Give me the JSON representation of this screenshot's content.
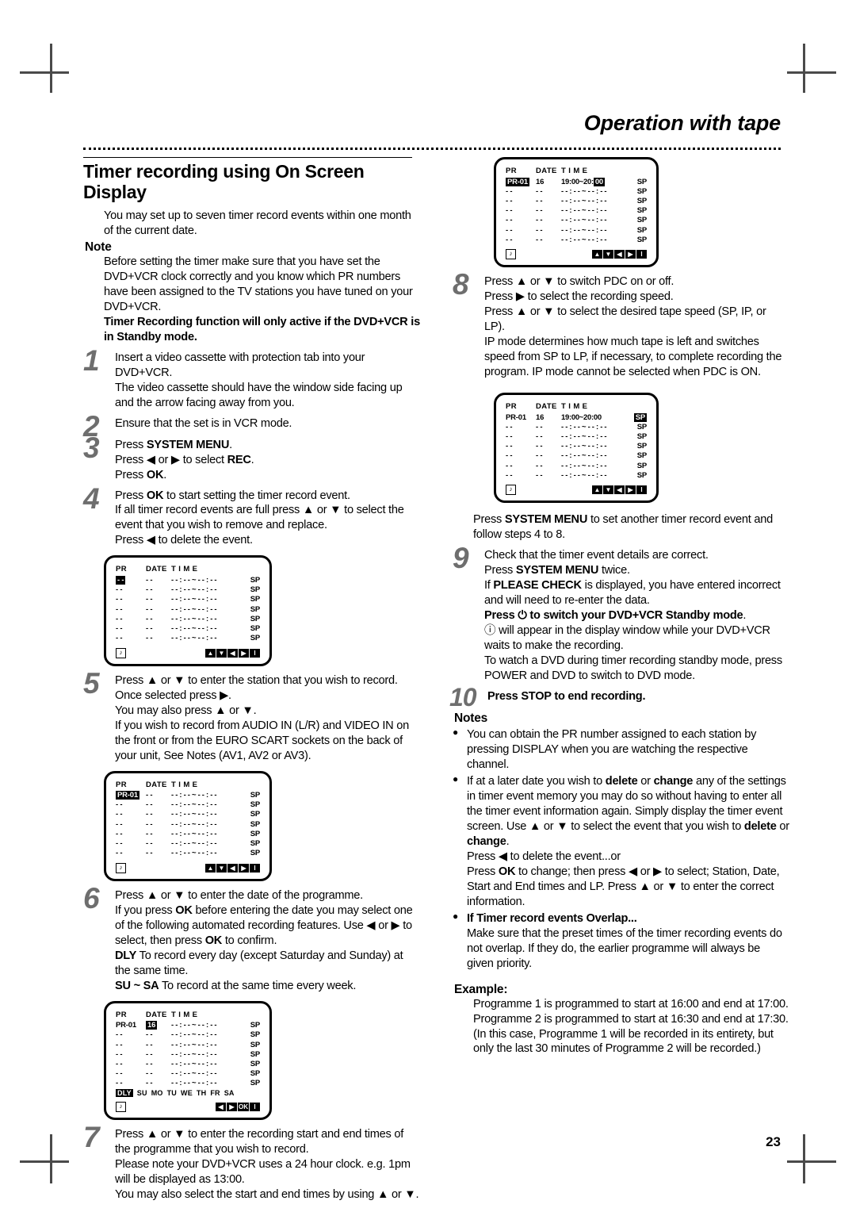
{
  "header": {
    "title": "Operation with tape"
  },
  "page_number": "23",
  "section": {
    "title_line1": "Timer recording using On Screen",
    "title_line2": "Display",
    "intro": "You may set up to seven timer record events within one month of the current date.",
    "note_heading": "Note",
    "note_body": "Before setting the timer make sure that you have set the DVD+VCR clock correctly and you know which PR numbers have been assigned to the TV stations you have tuned on your DVD+VCR.",
    "note_bold": "Timer Recording function will only active if the DVD+VCR is in Standby mode."
  },
  "steps": {
    "s1": {
      "num": "1",
      "line1": "Insert a video cassette with protection tab into your DVD+VCR.",
      "line2": "The video cassette should have the window side facing up and the arrow facing away from you."
    },
    "s2": {
      "num": "2",
      "line1": "Ensure that the set is in VCR mode."
    },
    "s3": {
      "num": "3",
      "l1a": "Press ",
      "l1b": "SYSTEM MENU",
      "l1c": ".",
      "l2a": "Press ◀ or ▶ to select ",
      "l2b": "REC",
      "l2c": ".",
      "l3a": "Press ",
      "l3b": "OK",
      "l3c": "."
    },
    "s4": {
      "num": "4",
      "l1a": "Press ",
      "l1b": "OK",
      "l1c": " to start setting the timer record event.",
      "line2": "If all timer record events are full press ▲ or ▼ to select the event that you wish to remove and replace.",
      "line3": "Press ◀ to delete the event."
    },
    "s5": {
      "num": "5",
      "line1": "Press ▲ or ▼ to enter the station that you wish to record.",
      "line2": "Once selected press ▶.",
      "line3": "You may also press ▲ or ▼.",
      "line4": "If you wish to record from AUDIO IN (L/R) and VIDEO IN on the front or from the EURO SCART sockets on the back of your unit, See Notes (AV1, AV2 or AV3)."
    },
    "s6": {
      "num": "6",
      "line1": "Press ▲ or ▼ to enter the date of the programme.",
      "l2a": "If you press ",
      "l2b": "OK",
      "l2c": " before entering the date you may select one of the following automated recording features. Use ◀ or ▶ to select, then press ",
      "l2d": "OK",
      "l2e": " to confirm.",
      "l3a": "DLY",
      "l3b": " To record every day (except Saturday and Sunday) at the same time.",
      "l4a": "SU ~ SA",
      "l4b": " To record at the same time every week."
    },
    "s7": {
      "num": "7",
      "line1": "Press ▲ or ▼ to enter the recording start and end times of the programme that you wish to record.",
      "line2": "Please note your DVD+VCR uses a 24 hour clock. e.g. 1pm will be displayed as 13:00.",
      "line3": "You may also select the start and end times by using ▲ or ▼."
    },
    "s8": {
      "num": "8",
      "line1": "Press ▲ or ▼ to switch PDC on or off.",
      "line2": "Press ▶ to select the recording speed.",
      "line3": "Press ▲ or ▼ to select the desired tape speed (SP, IP, or LP).",
      "line4": "IP mode determines how much tape is left and switches speed from SP to LP, if necessary, to complete recording the program. IP mode cannot be selected when PDC is ON."
    },
    "s8_after": {
      "l1a": "Press ",
      "l1b": "SYSTEM MENU",
      "l1c": " to set another timer record event and follow steps 4 to 8."
    },
    "s9": {
      "num": "9",
      "line1": "Check that the timer event details are correct.",
      "l2a": "Press ",
      "l2b": "SYSTEM MENU",
      "l2c": " twice.",
      "l3a": "If ",
      "l3b": "PLEASE CHECK",
      "l3c": " is displayed, you have entered incorrect and will need to re-enter the data.",
      "l4a": "Press ",
      "l4b": "⏻",
      "l4c": " to switch your DVD+VCR Standby mode",
      "l4d": ".",
      "l5a": "ⓘ",
      "l5b": " will appear in the display window while your DVD+VCR waits to make the recording.",
      "line6": "To watch a DVD during timer recording standby mode, press POWER and DVD to switch to DVD mode."
    },
    "s10": {
      "num": "10",
      "line1": "Press STOP to end recording."
    }
  },
  "notes": {
    "heading": "Notes",
    "b1": "You can obtain the PR number assigned to each station by pressing DISPLAY when you are watching the respective channel.",
    "b2a": "If at a later date you wish to ",
    "b2b": "delete",
    "b2c": " or ",
    "b2d": "change",
    "b2e": " any of the settings in timer event memory you may do so without having to enter all the timer event information again. Simply display the timer event screen. Use ▲ or ▼ to select the event that you wish to ",
    "b2f": "delete",
    "b2g": " or ",
    "b2h": "change",
    "b2i": ".",
    "b2_l2": "Press ◀ to delete the event...or",
    "b2_l3a": "Press ",
    "b2_l3b": "OK",
    "b2_l3c": " to change; then press ◀ or ▶ to select; Station, Date, Start and End times and LP. Press ▲ or ▼ to enter the correct information.",
    "b3_heading": "If Timer record events Overlap...",
    "b3_body": "Make sure that the preset times of the timer recording events do not overlap. If they do, the earlier programme will always be given priority.",
    "example_heading": "Example:",
    "example_l1": "Programme 1 is programmed to start at 16:00 and end at 17:00.",
    "example_l2": "Programme 2 is programmed to start at 16:30 and end at 17:30.",
    "example_l3": "(In this case, Programme 1 will be recorded in its entirety, but only the last 30 minutes of Programme 2 will be recorded.)"
  },
  "osd": {
    "headers": {
      "pr": "PR",
      "date": "DATE",
      "time": "T I M E"
    },
    "blank_pr": "- -",
    "blank_date": "- -",
    "blank_time": "- - : - - ~ - - : - -",
    "sp": "SP",
    "screen4": {
      "rows": [
        {
          "pr": "- -",
          "pr_hl": true,
          "date": "- -",
          "time": "- - : - - ~ - - : - -",
          "sp": "SP"
        },
        {
          "pr": "- -",
          "date": "- -",
          "time": "- - : - - ~ - - : - -",
          "sp": "SP"
        },
        {
          "pr": "- -",
          "date": "- -",
          "time": "- - : - - ~ - - : - -",
          "sp": "SP"
        },
        {
          "pr": "- -",
          "date": "- -",
          "time": "- - : - - ~ - - : - -",
          "sp": "SP"
        },
        {
          "pr": "- -",
          "date": "- -",
          "time": "- - : - - ~ - - : - -",
          "sp": "SP"
        },
        {
          "pr": "- -",
          "date": "- -",
          "time": "- - : - - ~ - - : - -",
          "sp": "SP"
        },
        {
          "pr": "- -",
          "date": "- -",
          "time": "- - : - - ~ - - : - -",
          "sp": "SP"
        }
      ],
      "keys": [
        "▲",
        "▼",
        "◀",
        "▶",
        "I"
      ]
    },
    "screen5": {
      "rows": [
        {
          "pr": "PR-01",
          "pr_hl": true,
          "date": "- -",
          "time": "- - : - - ~ - - : - -",
          "sp": "SP"
        },
        {
          "pr": "- -",
          "date": "- -",
          "time": "- - : - - ~ - - : - -",
          "sp": "SP"
        },
        {
          "pr": "- -",
          "date": "- -",
          "time": "- - : - - ~ - - : - -",
          "sp": "SP"
        },
        {
          "pr": "- -",
          "date": "- -",
          "time": "- - : - - ~ - - : - -",
          "sp": "SP"
        },
        {
          "pr": "- -",
          "date": "- -",
          "time": "- - : - - ~ - - : - -",
          "sp": "SP"
        },
        {
          "pr": "- -",
          "date": "- -",
          "time": "- - : - - ~ - - : - -",
          "sp": "SP"
        },
        {
          "pr": "- -",
          "date": "- -",
          "time": "- - : - - ~ - - : - -",
          "sp": "SP"
        }
      ],
      "keys": [
        "▲",
        "▼",
        "◀",
        "▶",
        "I"
      ]
    },
    "screen6": {
      "rows": [
        {
          "pr": "PR-01",
          "date": "16",
          "date_hl": true,
          "time": "- - : - - ~ - - : - -",
          "sp": "SP"
        },
        {
          "pr": "- -",
          "date": "- -",
          "time": "- - : - - ~ - - : - -",
          "sp": "SP"
        },
        {
          "pr": "- -",
          "date": "- -",
          "time": "- - : - - ~ - - : - -",
          "sp": "SP"
        },
        {
          "pr": "- -",
          "date": "- -",
          "time": "- - : - - ~ - - : - -",
          "sp": "SP"
        },
        {
          "pr": "- -",
          "date": "- -",
          "time": "- - : - - ~ - - : - -",
          "sp": "SP"
        },
        {
          "pr": "- -",
          "date": "- -",
          "time": "- - : - - ~ - - : - -",
          "sp": "SP"
        },
        {
          "pr": "- -",
          "date": "- -",
          "time": "- - : - - ~ - - : - -",
          "sp": "SP"
        }
      ],
      "days": [
        "DLY",
        "SU",
        "MO",
        "TU",
        "WE",
        "TH",
        "FR",
        "SA"
      ],
      "keys": [
        "◀",
        "▶",
        "OK",
        "I"
      ]
    },
    "screen8a": {
      "rows": [
        {
          "pr": "PR-01",
          "date": "16",
          "time_pre": "19:00~20:",
          "time_hl": "00",
          "sp": "SP"
        },
        {
          "pr": "- -",
          "date": "- -",
          "time": "- - : - - ~ - - : - -",
          "sp": "SP"
        },
        {
          "pr": "- -",
          "date": "- -",
          "time": "- - : - - ~ - - : - -",
          "sp": "SP"
        },
        {
          "pr": "- -",
          "date": "- -",
          "time": "- - : - - ~ - - : - -",
          "sp": "SP"
        },
        {
          "pr": "- -",
          "date": "- -",
          "time": "- - : - - ~ - - : - -",
          "sp": "SP"
        },
        {
          "pr": "- -",
          "date": "- -",
          "time": "- - : - - ~ - - : - -",
          "sp": "SP"
        },
        {
          "pr": "- -",
          "date": "- -",
          "time": "- - : - - ~ - - : - -",
          "sp": "SP"
        }
      ],
      "keys": [
        "▲",
        "▼",
        "◀",
        "▶",
        "I"
      ]
    },
    "screen8b": {
      "rows": [
        {
          "pr": "PR-01",
          "date": "16",
          "time": "19:00~20:00",
          "sp": "SP",
          "sp_hl": true
        },
        {
          "pr": "- -",
          "date": "- -",
          "time": "- - : - - ~ - - : - -",
          "sp": "SP"
        },
        {
          "pr": "- -",
          "date": "- -",
          "time": "- - : - - ~ - - : - -",
          "sp": "SP"
        },
        {
          "pr": "- -",
          "date": "- -",
          "time": "- - : - - ~ - - : - -",
          "sp": "SP"
        },
        {
          "pr": "- -",
          "date": "- -",
          "time": "- - : - - ~ - - : - -",
          "sp": "SP"
        },
        {
          "pr": "- -",
          "date": "- -",
          "time": "- - : - - ~ - - : - -",
          "sp": "SP"
        },
        {
          "pr": "- -",
          "date": "- -",
          "time": "- - : - - ~ - - : - -",
          "sp": "SP"
        }
      ],
      "keys": [
        "▲",
        "▼",
        "◀",
        "▶",
        "I"
      ]
    },
    "clock_icon": "♪"
  }
}
